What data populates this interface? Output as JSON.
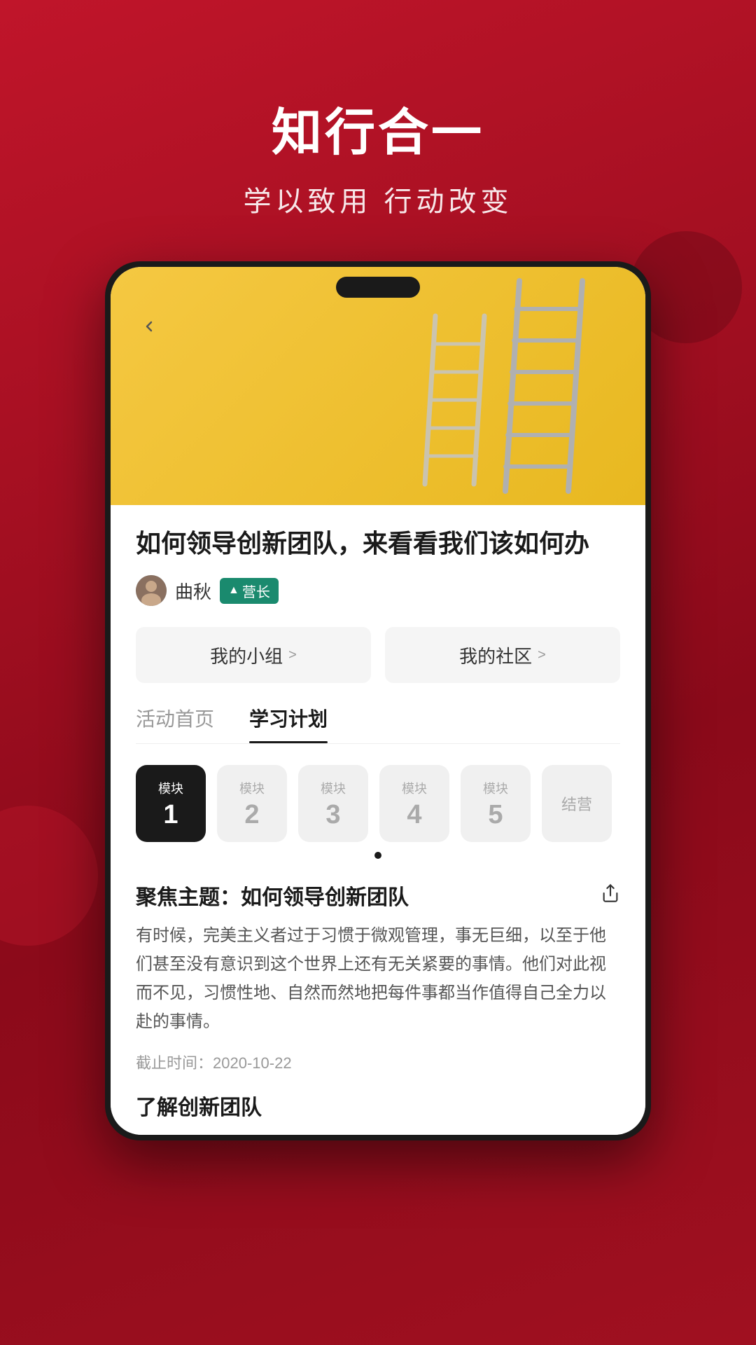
{
  "background": {
    "color_top": "#c0152a",
    "color_bottom": "#8b0a1a"
  },
  "header": {
    "title": "知行合一",
    "subtitle": "学以致用 行动改变"
  },
  "phone": {
    "article": {
      "title": "如何领导创新团队，来看看我们该如何办",
      "author_name": "曲秋",
      "author_badge": "营长",
      "nav_group_label": "我的小组",
      "nav_group_arrow": ">",
      "nav_community_label": "我的社区",
      "nav_community_arrow": ">"
    },
    "tabs": [
      {
        "label": "活动首页",
        "active": false
      },
      {
        "label": "学习计划",
        "active": true
      }
    ],
    "modules": [
      {
        "label": "模块",
        "num": "1",
        "active": true
      },
      {
        "label": "模块",
        "num": "2",
        "active": false
      },
      {
        "label": "模块",
        "num": "3",
        "active": false
      },
      {
        "label": "模块",
        "num": "4",
        "active": false
      },
      {
        "label": "模块",
        "num": "5",
        "active": false
      },
      {
        "label": "结营",
        "num": "",
        "active": false
      }
    ],
    "focus_section": {
      "title": "聚焦主题：如何领导创新团队",
      "body": "有时候，完美主义者过于习惯于微观管理，事无巨细，以至于他们甚至没有意识到这个世界上还有无关紧要的事情。他们对此视而不见，习惯性地、自然而然地把每件事都当作值得自己全力以赴的事情。",
      "deadline_label": "截止时间：",
      "deadline_value": "2020-10-22"
    },
    "understand_title": "了解创新团队"
  }
}
